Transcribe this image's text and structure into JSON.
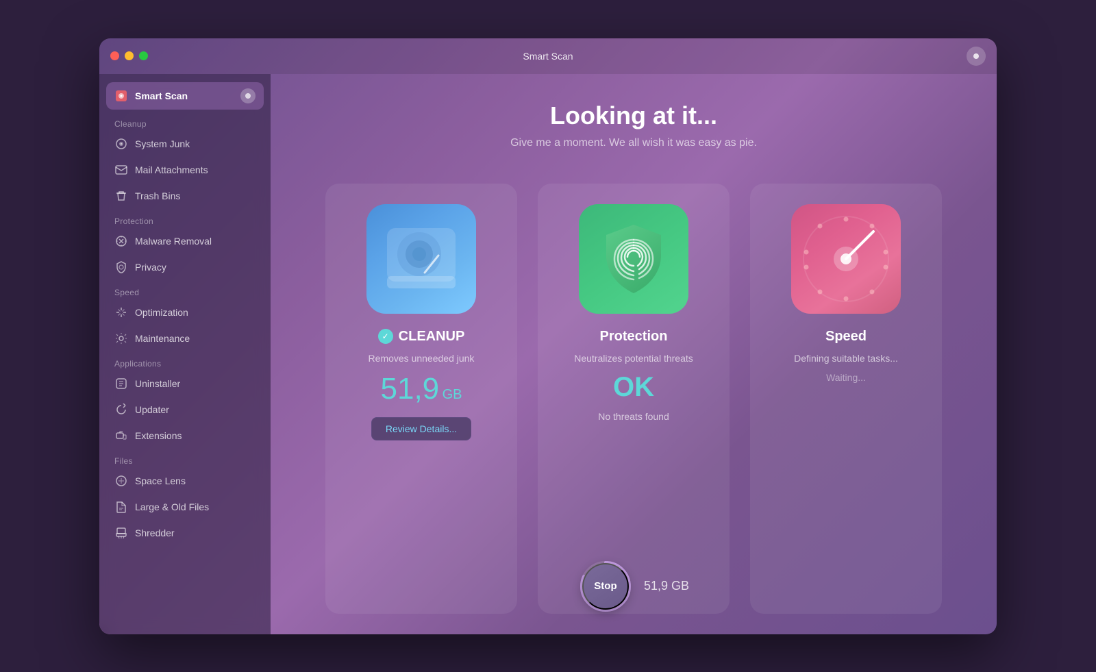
{
  "window": {
    "title": "Smart Scan"
  },
  "titlebar": {
    "dots_color": [
      "#ff5f57",
      "#febc2e",
      "#28c840"
    ]
  },
  "sidebar": {
    "active_item": "Smart Scan",
    "sections": [
      {
        "label": null,
        "items": [
          {
            "id": "smart-scan",
            "label": "Smart Scan",
            "icon": "scan-icon",
            "active": true
          }
        ]
      },
      {
        "label": "Cleanup",
        "items": [
          {
            "id": "system-junk",
            "label": "System Junk",
            "icon": "junk-icon"
          },
          {
            "id": "mail-attachments",
            "label": "Mail Attachments",
            "icon": "mail-icon"
          },
          {
            "id": "trash-bins",
            "label": "Trash Bins",
            "icon": "trash-icon"
          }
        ]
      },
      {
        "label": "Protection",
        "items": [
          {
            "id": "malware-removal",
            "label": "Malware Removal",
            "icon": "malware-icon"
          },
          {
            "id": "privacy",
            "label": "Privacy",
            "icon": "privacy-icon"
          }
        ]
      },
      {
        "label": "Speed",
        "items": [
          {
            "id": "optimization",
            "label": "Optimization",
            "icon": "optimization-icon"
          },
          {
            "id": "maintenance",
            "label": "Maintenance",
            "icon": "maintenance-icon"
          }
        ]
      },
      {
        "label": "Applications",
        "items": [
          {
            "id": "uninstaller",
            "label": "Uninstaller",
            "icon": "uninstaller-icon"
          },
          {
            "id": "updater",
            "label": "Updater",
            "icon": "updater-icon"
          },
          {
            "id": "extensions",
            "label": "Extensions",
            "icon": "extensions-icon"
          }
        ]
      },
      {
        "label": "Files",
        "items": [
          {
            "id": "space-lens",
            "label": "Space Lens",
            "icon": "space-icon"
          },
          {
            "id": "large-old-files",
            "label": "Large & Old Files",
            "icon": "files-icon"
          },
          {
            "id": "shredder",
            "label": "Shredder",
            "icon": "shredder-icon"
          }
        ]
      }
    ]
  },
  "main": {
    "title": "Looking at it...",
    "subtitle": "Give me a moment. We all wish it was easy as pie.",
    "cards": [
      {
        "id": "cleanup",
        "title": "CLEANUP",
        "check": true,
        "description": "Removes unneeded junk",
        "value": "51,9",
        "unit": "GB",
        "action_label": "Review Details...",
        "status": null,
        "status2": null
      },
      {
        "id": "protection",
        "title": "Protection",
        "check": false,
        "description": "Neutralizes potential threats",
        "value": null,
        "unit": null,
        "ok_text": "OK",
        "status": "No threats found",
        "action_label": null,
        "status2": null
      },
      {
        "id": "speed",
        "title": "Speed",
        "check": false,
        "description": "Defining suitable tasks...",
        "value": null,
        "unit": null,
        "ok_text": null,
        "status": null,
        "action_label": null,
        "status2": "Waiting..."
      }
    ],
    "stop_button_label": "Stop",
    "stop_gb": "51,9 GB"
  }
}
